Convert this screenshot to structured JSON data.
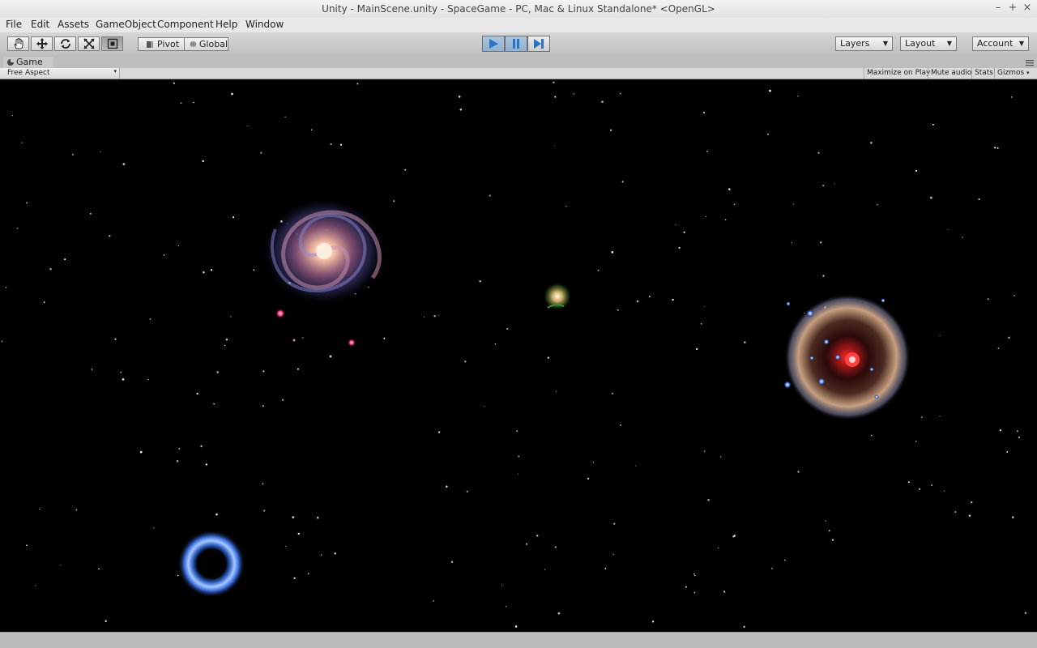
{
  "window": {
    "title": "Unity - MainScene.unity - SpaceGame - PC, Mac & Linux Standalone* <OpenGL>",
    "controls": [
      "–",
      "+",
      "×"
    ]
  },
  "menu": [
    "File",
    "Edit",
    "Assets",
    "GameObject",
    "Component",
    "Help",
    "Window"
  ],
  "toolbar": {
    "tools": [
      {
        "name": "hand-tool",
        "icon": "hand-icon",
        "active": false
      },
      {
        "name": "move-tool",
        "icon": "move-icon",
        "active": false
      },
      {
        "name": "rotate-tool",
        "icon": "rotate-icon",
        "active": false
      },
      {
        "name": "scale-tool",
        "icon": "scale-icon",
        "active": false
      },
      {
        "name": "rect-tool",
        "icon": "rect-icon",
        "active": true
      }
    ],
    "pivot_label": "Pivot",
    "global_label": "Global",
    "playback": {
      "play_active": true,
      "pause_active": true
    },
    "layers_label": "Layers",
    "layout_label": "Layout",
    "account_label": "Account"
  },
  "game_view": {
    "tab_label": "Game",
    "aspect_label": "Free Aspect",
    "buttons": [
      "Maximize on Play",
      "Mute audio",
      "Stats",
      "Gizmos"
    ],
    "background_color": "#000000",
    "objects": [
      "spiral-galaxy",
      "small-nebula",
      "red-star-nebula",
      "blue-black-hole"
    ]
  },
  "colors": {
    "play_active": "#8fb0cf",
    "accent_blue": "#2a74c8",
    "viewport": "#000000"
  }
}
